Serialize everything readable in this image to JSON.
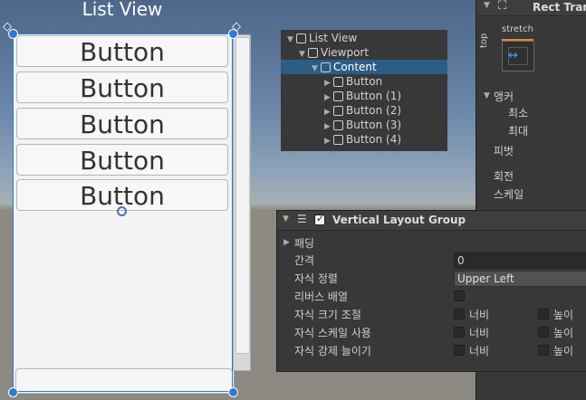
{
  "scene": {
    "title": "List View",
    "buttons": [
      "Button",
      "Button",
      "Button",
      "Button",
      "Button"
    ]
  },
  "hierarchy": {
    "items": [
      {
        "label": "List View",
        "expanded": true,
        "selected": false
      },
      {
        "label": "Viewport",
        "expanded": true,
        "selected": false
      },
      {
        "label": "Content",
        "expanded": true,
        "selected": true
      },
      {
        "label": "Button",
        "expanded": false,
        "selected": false
      },
      {
        "label": "Button (1)",
        "expanded": false,
        "selected": false
      },
      {
        "label": "Button (2)",
        "expanded": false,
        "selected": false
      },
      {
        "label": "Button (3)",
        "expanded": false,
        "selected": false
      },
      {
        "label": "Button (4)",
        "expanded": false,
        "selected": false
      }
    ]
  },
  "inspector": {
    "rect_transform_title": "Rect Tran",
    "anchor_preset_label": "stretch",
    "anchor_side_label": "top",
    "anchors_label": "앵커",
    "min_label": "최소",
    "max_label": "최대",
    "pivot_label": "피벗",
    "rotation_label": "회전",
    "scale_label": "스케일"
  },
  "vertical_layout_group": {
    "title": "Vertical Layout Group",
    "enabled": true,
    "padding_label": "패딩",
    "spacing_label": "간격",
    "spacing_value": "0",
    "child_alignment_label": "자식 정렬",
    "child_alignment_value": "Upper Left",
    "reverse_label": "리버스 배열",
    "control_size_label": "자식 크기 조절",
    "use_scale_label": "자식 스케일 사용",
    "force_expand_label": "자식 강제 늘이기",
    "width_label": "너비",
    "height_label": "높이"
  }
}
